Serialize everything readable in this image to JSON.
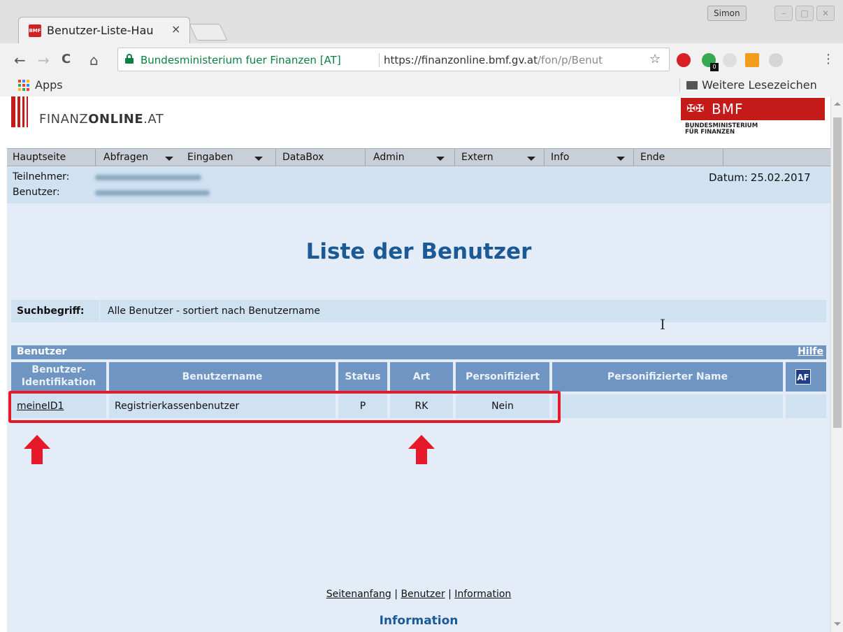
{
  "browser": {
    "tab_title": "Benutzer-Liste-Hau",
    "tab_close": "×",
    "favicon_text": "BMF",
    "profile_name": "Simon",
    "window_buttons": [
      "–",
      "□",
      "✕"
    ],
    "nav": {
      "back": "←",
      "forward": "→",
      "reload": "C",
      "home": "⌂"
    },
    "org_name": "Bundesministerium fuer Finanzen [AT]",
    "url_scheme": "https://",
    "url_host": "finanzonline.bmf.gv.at",
    "url_path": "/fon/p/Benut",
    "star": "☆",
    "menu": "⋮",
    "extensions": [
      "adblock-icon",
      "download-icon",
      "extension-icon",
      "chart-icon",
      "shield-icon"
    ],
    "extension_badge": "0",
    "bookmarks": {
      "apps_label": "Apps",
      "other_label": "Weitere Lesezeichen"
    }
  },
  "site": {
    "logo_text_light": "FINANZ",
    "logo_text_bold": "ONLINE",
    "logo_text_suffix": ".AT",
    "bmf_label": "BMF",
    "bmf_subtitle": "BUNDESMINISTERIUM\nFÜR FINANZEN"
  },
  "navbar": {
    "items": [
      {
        "label": "Hauptseite",
        "dropdown": false
      },
      {
        "label": "Abfragen",
        "dropdown": true
      },
      {
        "label": "Eingaben",
        "dropdown": true
      },
      {
        "label": "DataBox",
        "dropdown": false
      },
      {
        "label": "Admin",
        "dropdown": true
      },
      {
        "label": "Extern",
        "dropdown": true
      },
      {
        "label": "Info",
        "dropdown": true
      },
      {
        "label": "Ende",
        "dropdown": false
      }
    ]
  },
  "info": {
    "teilnehmer_label": "Teilnehmer:",
    "benutzer_label": "Benutzer:",
    "datum_label": "Datum:",
    "datum_value": "25.02.2017"
  },
  "page": {
    "heading": "Liste der Benutzer",
    "search_label": "Suchbegriff:",
    "search_value": "Alle Benutzer - sortiert nach Benutzername"
  },
  "table": {
    "title": "Benutzer",
    "help": "Hilfe",
    "columns": [
      {
        "label": "Benutzer-",
        "label2": "Identifikation"
      },
      {
        "label": "Benutzername"
      },
      {
        "label": "Status"
      },
      {
        "label": "Art"
      },
      {
        "label": "Personifiziert"
      },
      {
        "label": "Personifizierter Name"
      }
    ],
    "af_icon": "AF",
    "rows": [
      {
        "id": "meineID1",
        "name": "Registrierkassenbenutzer",
        "status": "P",
        "art": "RK",
        "personifiziert": "Nein",
        "personifizierter_name": ""
      }
    ]
  },
  "footer": {
    "links": [
      "Seitenanfang",
      "Benutzer",
      "Information"
    ],
    "separator": "|",
    "section_title": "Information"
  },
  "annotation_color": "#e6192a"
}
